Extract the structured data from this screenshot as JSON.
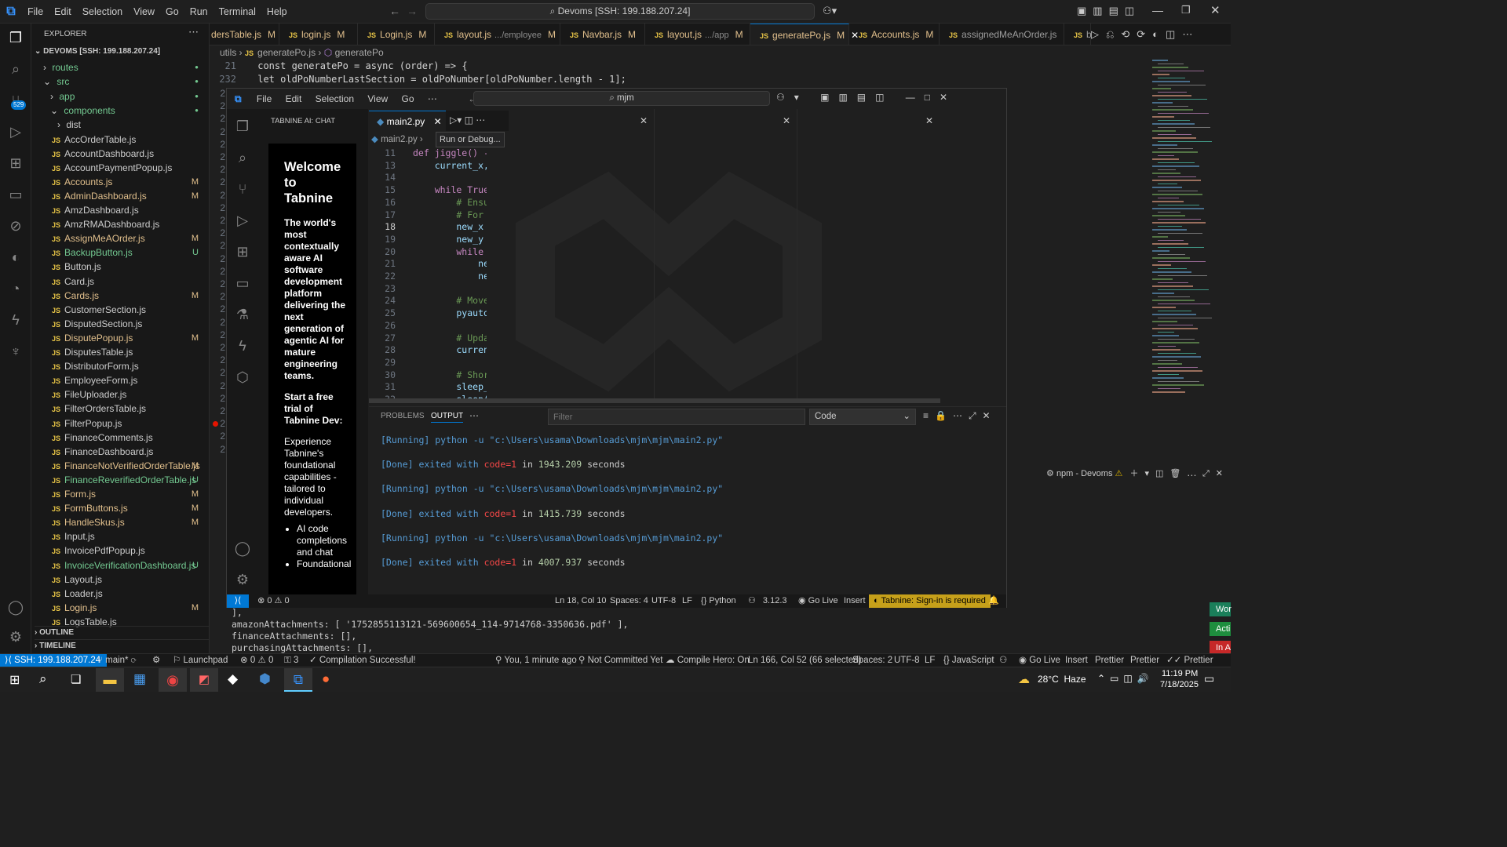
{
  "menu": [
    "File",
    "Edit",
    "Selection",
    "View",
    "Go",
    "Run",
    "Terminal",
    "Help"
  ],
  "command_center": "Devoms [SSH: 199.188.207.24]",
  "explorer": {
    "title": "EXPLORER",
    "root": "DEVOMS [SSH: 199.188.207.24]",
    "folders": [
      {
        "label": "routes",
        "indent": 1
      },
      {
        "label": "src",
        "indent": 1,
        "open": true
      },
      {
        "label": "app",
        "indent": 2
      },
      {
        "label": "components",
        "indent": 2,
        "open": true
      },
      {
        "label": "dist",
        "indent": 3
      }
    ],
    "files": [
      {
        "name": "AccOrderTable.js",
        "status": ""
      },
      {
        "name": "AccountDashboard.js",
        "status": ""
      },
      {
        "name": "AccountPaymentPopup.js",
        "status": ""
      },
      {
        "name": "Accounts.js",
        "status": "M"
      },
      {
        "name": "AdminDashboard.js",
        "status": "M"
      },
      {
        "name": "AmzDashboard.js",
        "status": ""
      },
      {
        "name": "AmzRMADashboard.js",
        "status": ""
      },
      {
        "name": "AssignMeAOrder.js",
        "status": "M"
      },
      {
        "name": "BackupButton.js",
        "status": "U"
      },
      {
        "name": "Button.js",
        "status": ""
      },
      {
        "name": "Card.js",
        "status": ""
      },
      {
        "name": "Cards.js",
        "status": "M"
      },
      {
        "name": "CustomerSection.js",
        "status": ""
      },
      {
        "name": "DisputedSection.js",
        "status": ""
      },
      {
        "name": "DisputePopup.js",
        "status": "M"
      },
      {
        "name": "DisputesTable.js",
        "status": ""
      },
      {
        "name": "DistributorForm.js",
        "status": ""
      },
      {
        "name": "EmployeeForm.js",
        "status": ""
      },
      {
        "name": "FileUploader.js",
        "status": ""
      },
      {
        "name": "FilterOrdersTable.js",
        "status": ""
      },
      {
        "name": "FilterPopup.js",
        "status": ""
      },
      {
        "name": "FinanceComments.js",
        "status": ""
      },
      {
        "name": "FinanceDashboard.js",
        "status": ""
      },
      {
        "name": "FinanceNotVerifiedOrderTable.js",
        "status": "M"
      },
      {
        "name": "FinanceReverifiedOrderTable.js",
        "status": "U"
      },
      {
        "name": "Form.js",
        "status": "M"
      },
      {
        "name": "FormButtons.js",
        "status": "M"
      },
      {
        "name": "HandleSkus.js",
        "status": "M"
      },
      {
        "name": "Input.js",
        "status": ""
      },
      {
        "name": "InvoicePdfPopup.js",
        "status": ""
      },
      {
        "name": "InvoiceVerificationDashboard.js",
        "status": "U"
      },
      {
        "name": "Layout.js",
        "status": ""
      },
      {
        "name": "Loader.js",
        "status": ""
      },
      {
        "name": "Login.js",
        "status": "M"
      },
      {
        "name": "LogsTable.js",
        "status": ""
      }
    ],
    "outline": "OUTLINE",
    "timeline": "TIMELINE",
    "scm_badge": "529"
  },
  "tabs": [
    {
      "label": "dersTable.js",
      "mark": "M"
    },
    {
      "label": "login.js",
      "mark": "M"
    },
    {
      "label": "Login.js",
      "mark": "M"
    },
    {
      "label": "layout.js",
      "sub": ".../employee",
      "mark": "M"
    },
    {
      "label": "Navbar.js",
      "mark": "M"
    },
    {
      "label": "layout.js",
      "sub": ".../app",
      "mark": "M"
    },
    {
      "label": "generatePo.js",
      "mark": "M",
      "active": true
    },
    {
      "label": "Accounts.js",
      "mark": "M"
    },
    {
      "label": "assignedMeAnOrder.js",
      "mark": ""
    },
    {
      "label": "b",
      "mark": ""
    }
  ],
  "breadcrumb": {
    "folder": "utils",
    "file": "generatePo.js",
    "symbol": "generatePo"
  },
  "outer_code": {
    "line21_num": "21",
    "line21": "const generatePo = async (order) => {",
    "line232_num": "232",
    "line232": "  let oldPoNumberLastSection = oldPoNumber[oldPoNumber.length - 1];"
  },
  "inner": {
    "menu": [
      "File",
      "Edit",
      "Selection",
      "View",
      "Go"
    ],
    "search": "mjm",
    "panel_title": "TABNINE AI: CHAT",
    "tab": "main2.py",
    "crumb_file": "main2.py",
    "tooltip": "Run or Debug...",
    "lines": [
      {
        "n": "11",
        "t": "def jiggle() ->"
      },
      {
        "n": "13",
        "t": "    current_x,"
      },
      {
        "n": "14",
        "t": ""
      },
      {
        "n": "15",
        "t": "    while True:"
      },
      {
        "n": "16",
        "t": "        # Ensur"
      },
      {
        "n": "17",
        "t": "        # For e"
      },
      {
        "n": "18",
        "t": "        new_x ="
      },
      {
        "n": "19",
        "t": "        new_y ="
      },
      {
        "n": "20",
        "t": "        while a"
      },
      {
        "n": "21",
        "t": "            new"
      },
      {
        "n": "22",
        "t": "            new"
      },
      {
        "n": "23",
        "t": ""
      },
      {
        "n": "24",
        "t": "        # Move "
      },
      {
        "n": "25",
        "t": "        pyautog"
      },
      {
        "n": "26",
        "t": ""
      },
      {
        "n": "27",
        "t": "        # Updat"
      },
      {
        "n": "28",
        "t": "        current"
      },
      {
        "n": "29",
        "t": ""
      },
      {
        "n": "30",
        "t": "        # Short"
      },
      {
        "n": "31",
        "t": "        sleep_t"
      },
      {
        "n": "32",
        "t": "        sleep(s"
      }
    ],
    "welcome_title": "Welcome to Tabnine",
    "welcome_p1": "The world's most contextually aware AI software development platform delivering the next generation of agentic AI for mature engineering teams.",
    "welcome_p2": "Start a free trial of Tabnine Dev:",
    "welcome_p3": "Experience Tabnine's foundational capabilities - tailored to individual developers.",
    "bullets": [
      "AI code completions and chat",
      "Foundational"
    ],
    "panel_tabs": [
      "PROBLEMS",
      "OUTPUT"
    ],
    "filter_placeholder": "Filter",
    "output_channel": "Code",
    "output": [
      {
        "kind": "run",
        "text": "[Running] python -u \"c:\\Users\\usama\\Downloads\\mjm\\mjm\\main2.py\""
      },
      {
        "kind": "done",
        "pre": "[Done] exited with ",
        "code": "code=1",
        "mid": " in ",
        "secs": "1943.209",
        "post": " seconds"
      },
      {
        "kind": "run",
        "text": "[Running] python -u \"c:\\Users\\usama\\Downloads\\mjm\\mjm\\main2.py\""
      },
      {
        "kind": "done",
        "pre": "[Done] exited with ",
        "code": "code=1",
        "mid": " in ",
        "secs": "1415.739",
        "post": " seconds"
      },
      {
        "kind": "run",
        "text": "[Running] python -u \"c:\\Users\\usama\\Downloads\\mjm\\mjm\\main2.py\""
      },
      {
        "kind": "done",
        "pre": "[Done] exited with ",
        "code": "code=1",
        "mid": " in ",
        "secs": "4007.937",
        "post": " seconds"
      }
    ],
    "status": {
      "errors": "0",
      "warnings": "0",
      "pos": "Ln 18, Col 10",
      "spaces": "Spaces: 4",
      "enc": "UTF-8",
      "eol": "LF",
      "lang": "Python",
      "ver": "3.12.3",
      "golive": "Go Live",
      "mode": "Insert",
      "tabnine": "Tabnine: Sign-in is required"
    }
  },
  "terminal": {
    "label": "npm - Devoms",
    "lines": [
      "],",
      "amazonAttachments: [ '1752855113121-569600654_114-9714768-3350636.pdf' ],",
      "financeAttachments: [],",
      "purchasingAttachments: [],"
    ]
  },
  "side_buttons": [
    "Wor",
    "Acti",
    "In A"
  ],
  "statusbar": {
    "remote": "SSH: 199.188.207.24",
    "branch": "main*",
    "errors": "0",
    "warnings": "0",
    "ports": "3",
    "launchpad": "Launchpad",
    "compile": "Compilation Successful!",
    "blame": "You, 1 minute ago",
    "commit": "Not Committed Yet",
    "hero": "Compile Hero: On",
    "pos": "Ln 166, Col 52 (66 selected)",
    "spaces": "Spaces: 2",
    "enc": "UTF-8",
    "eol": "LF",
    "lang": "JavaScript",
    "golive": "Go Live",
    "mode": "Insert",
    "prettier1": "Prettier",
    "prettier2": "Prettier",
    "prettier3": "Prettier"
  },
  "taskbar": {
    "weather": "28°C  Haze",
    "time": "11:19 PM",
    "date": "7/18/2025"
  },
  "colors": {
    "accent": "#0078d4",
    "modified": "#e2c08d",
    "untracked": "#73c991",
    "tabnine": "#c6a01a"
  }
}
